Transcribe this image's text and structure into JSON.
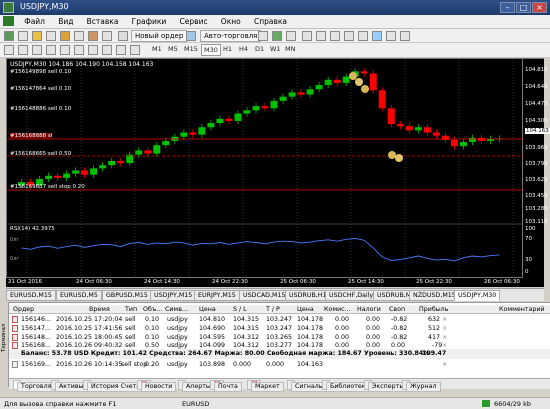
{
  "window": {
    "title": "USDJPY,M30"
  },
  "menu": [
    "Файл",
    "Вид",
    "Вставка",
    "Графики",
    "Сервис",
    "Окно",
    "Справка"
  ],
  "toolbar": {
    "new_order": "Новый ордер",
    "auto_trading": "Авто-торговля",
    "timeframes": [
      "M1",
      "M5",
      "M15",
      "M30",
      "H1",
      "H4",
      "D1",
      "W1",
      "MN"
    ]
  },
  "chart": {
    "symbol_info": "USDJPY,M30  104.186 104.190 104.158 104.163",
    "prices": [
      "104.815",
      "104.645",
      "104.475",
      "104.305",
      "104.163",
      "103.965",
      "103.795",
      "103.625",
      "103.455",
      "103.285",
      "103.115",
      "103.4645"
    ],
    "order_labels": [
      "#156149898 sell 0.10",
      "#156147864 sell 0.10",
      "#156148886 sell 0.10",
      "#156168888 sl",
      "#156168665 sell 0.50",
      "#156169837 sell stop 0.20"
    ],
    "rsi_label": "RSI(14) 42.3975",
    "rsi_scale": [
      "100",
      "70",
      "30",
      "0"
    ],
    "time_labels": [
      "21 Oct 2016",
      "24 Oct 06:30",
      "24 Oct 14:30",
      "24 Oct 22:30",
      "25 Oct 06:30",
      "25 Oct 14:30",
      "25 Oct 22:30",
      "26 Oct 06:30"
    ],
    "data": {
      "closes": [
        103.75,
        103.72,
        103.78,
        103.81,
        103.79,
        103.83,
        103.86,
        103.82,
        103.88,
        103.91,
        103.95,
        103.93,
        104.01,
        104.05,
        104.02,
        104.1,
        104.14,
        104.18,
        104.22,
        104.2,
        104.27,
        104.31,
        104.35,
        104.33,
        104.4,
        104.43,
        104.47,
        104.45,
        104.52,
        104.56,
        104.6,
        104.58,
        104.63,
        104.67,
        104.72,
        104.69,
        104.75,
        104.8,
        104.78,
        104.62,
        104.45,
        104.3,
        104.28,
        104.24,
        104.27,
        104.22,
        104.19,
        104.15,
        104.09,
        104.13,
        104.17,
        104.14,
        104.16,
        104.163
      ],
      "rsi": [
        58,
        55,
        60,
        62,
        57,
        61,
        64,
        59,
        63,
        66,
        65,
        61,
        68,
        70,
        66,
        69,
        67,
        71,
        69,
        64,
        68,
        67,
        70,
        66,
        69,
        72,
        70,
        67,
        71,
        73,
        72,
        69,
        71,
        74,
        76,
        73,
        77,
        79,
        75,
        58,
        38,
        30,
        32,
        36,
        40,
        35,
        31,
        33,
        29,
        36,
        40,
        38,
        41,
        42.4
      ]
    }
  },
  "chart_tabs": [
    "EURUSD,M15",
    "EURUSD,M5",
    "GBPUSD,M15",
    "USDJPY,M15",
    "EURJPY,M15",
    "USDCAD,M15",
    "USDRUB,H1",
    "USDCHF,Daily",
    "USDRUB,M5",
    "NZDUSD,M15",
    "USDJPY,M30"
  ],
  "orders": {
    "headers": [
      "Ордер",
      "Время",
      "Тип",
      "Объ...",
      "Симв...",
      "Цена",
      "S / L",
      "T / P",
      "Цена",
      "Комис...",
      "Налоги",
      "Своп",
      "Прибыль",
      "Комментарий"
    ],
    "rows": [
      [
        "156146...",
        "2016.10.25 17:20:04",
        "sell",
        "0.10",
        "usdjpy",
        "104.810",
        "104.315",
        "103.247",
        "104.178",
        "0.00",
        "0.00",
        "-0.82",
        "632"
      ],
      [
        "156147...",
        "2016.10.25 17:41:56",
        "sell",
        "0.10",
        "usdjpy",
        "104.690",
        "104.315",
        "103.247",
        "104.178",
        "0.00",
        "0.00",
        "-0.82",
        "512"
      ],
      [
        "156148...",
        "2016.10.25 18:00:45",
        "sell",
        "0.10",
        "usdjpy",
        "104.595",
        "104.312",
        "103.265",
        "104.178",
        "0.00",
        "0.00",
        "-0.82",
        "417"
      ],
      [
        "156168...",
        "2016.10.26 09:40:32",
        "sell",
        "0.50",
        "usdjpy",
        "104.099",
        "104.312",
        "103.277",
        "104.178",
        "0.00",
        "0.00",
        "0.00",
        "-79"
      ]
    ],
    "balance": "Баланс: 53.78 USD  Кредит: 101.42  Средства: 264.67  Маржа: 80.00  Свободная маржа: 184.67  Уровень: 330.84%",
    "balance_profit": "109.47",
    "pending_row": [
      "156169...",
      "2016.10.26 10:14:35",
      "sell stop",
      "0.20",
      "usdjpy",
      "103.898",
      "0.000",
      "0.000",
      "104.163"
    ]
  },
  "terminal_side_label": "Терминал",
  "terminal_tabs": [
    {
      "label": "Торговля",
      "badge": ""
    },
    {
      "label": "Активы",
      "badge": ""
    },
    {
      "label": "История Счета",
      "badge": ""
    },
    {
      "label": "Новости",
      "badge": "99"
    },
    {
      "label": "Алерты",
      "badge": ""
    },
    {
      "label": "Почта",
      "badge": "26"
    },
    {
      "label": "Маркет",
      "badge": "37"
    },
    {
      "label": "Сигналы",
      "badge": ""
    },
    {
      "label": "Библиотека",
      "badge": ""
    },
    {
      "label": "Эксперты",
      "badge": ""
    },
    {
      "label": "Журнал",
      "badge": ""
    }
  ],
  "statusbar": {
    "help": "Для вызова справки нажмите F1",
    "profile": "EURUSD",
    "traffic": "6604/29 kb"
  },
  "colors": {
    "up": "#00c000",
    "down": "#ff0000",
    "grid": "#303030",
    "bg": "#000000"
  }
}
